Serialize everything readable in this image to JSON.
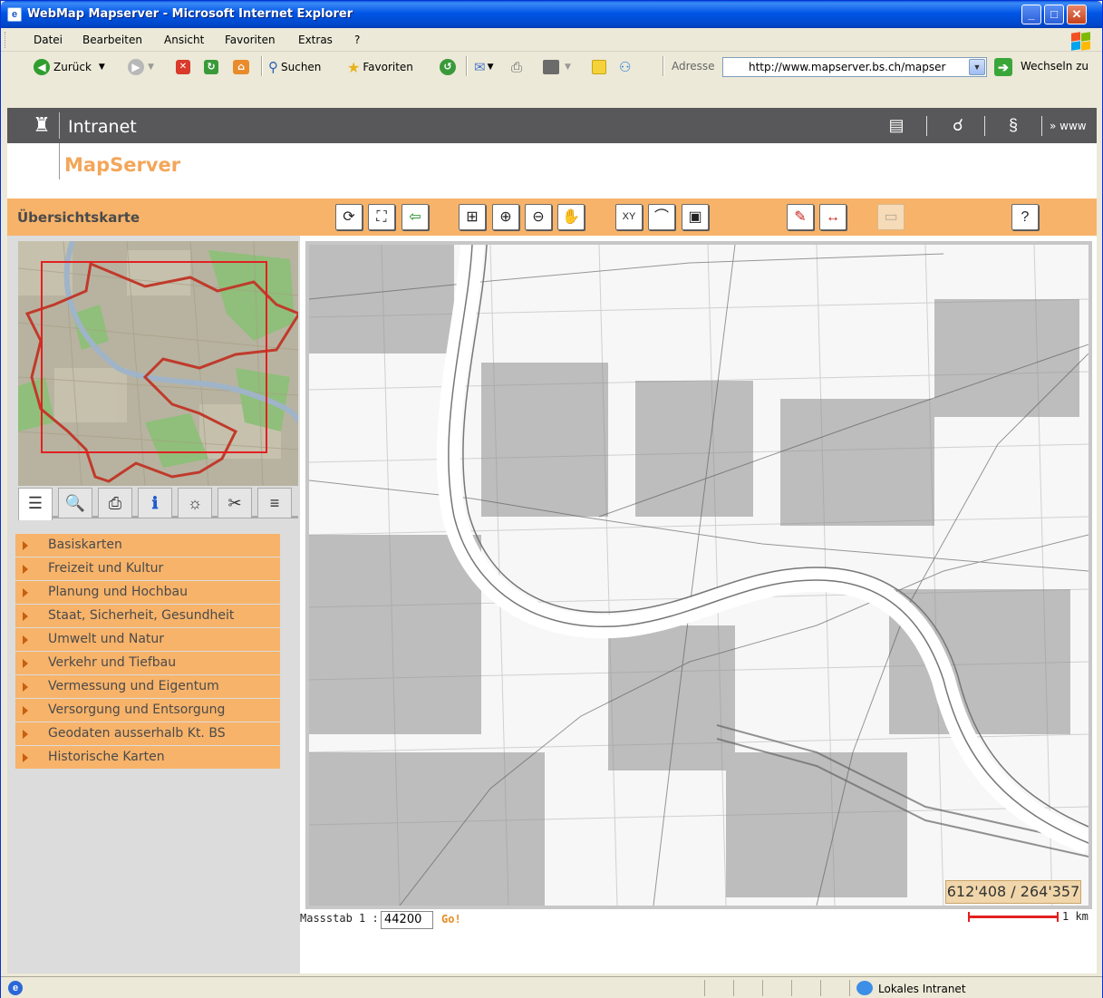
{
  "window": {
    "title": "WebMap Mapserver - Microsoft Internet Explorer",
    "minimize": "_",
    "maximize": "□",
    "close": "✕"
  },
  "menu": [
    "Datei",
    "Bearbeiten",
    "Ansicht",
    "Favoriten",
    "Extras",
    "?"
  ],
  "toolbar": {
    "back": "Zurück",
    "search": "Suchen",
    "favorites": "Favoriten",
    "address_label": "Adresse",
    "address_value": "http://www.mapserver.bs.ch/mapser",
    "go": "Wechseln zu"
  },
  "header": {
    "intranet": "Intranet",
    "www": "» www",
    "app_name": "MapServer"
  },
  "panel": {
    "overview_title": "Übersichtskarte"
  },
  "map_tools": [
    {
      "name": "refresh-icon",
      "glyph": "⟳"
    },
    {
      "name": "full-extent-icon",
      "glyph": "⛶"
    },
    {
      "name": "back-arrow-icon",
      "glyph": "⇦"
    },
    {
      "name": "zoom-box-icon",
      "glyph": "⊞"
    },
    {
      "name": "zoom-in-icon",
      "glyph": "⊕"
    },
    {
      "name": "zoom-out-icon",
      "glyph": "⊖"
    },
    {
      "name": "pan-hand-icon",
      "glyph": "✋"
    },
    {
      "name": "xy-coordinate-icon",
      "glyph": "XY"
    },
    {
      "name": "measure-distance-icon",
      "glyph": "⌒"
    },
    {
      "name": "measure-area-icon",
      "glyph": "▣"
    },
    {
      "name": "label-text-icon",
      "glyph": "✎"
    },
    {
      "name": "distance-arrow-icon",
      "glyph": "↔"
    },
    {
      "name": "clear-graphics-icon",
      "glyph": "▭"
    },
    {
      "name": "help-icon",
      "glyph": "?"
    }
  ],
  "tabs": [
    {
      "name": "legend-tab-icon",
      "glyph": "☰"
    },
    {
      "name": "search-tab-icon",
      "glyph": "🔍"
    },
    {
      "name": "print-tab-icon",
      "glyph": "⎙"
    },
    {
      "name": "info-tab-icon",
      "glyph": "ℹ"
    },
    {
      "name": "query-tab-icon",
      "glyph": "☼"
    },
    {
      "name": "tools-tab-icon",
      "glyph": "✂"
    },
    {
      "name": "layers-tab-icon",
      "glyph": "≡"
    }
  ],
  "layers": [
    "Basiskarten",
    "Freizeit und Kultur",
    "Planung und Hochbau",
    "Staat, Sicherheit, Gesundheit",
    "Umwelt und Natur",
    "Verkehr und Tiefbau",
    "Vermessung und Eigentum",
    "Versorgung und Entsorgung",
    "Geodaten ausserhalb Kt. BS",
    "Historische Karten"
  ],
  "map": {
    "coordinates": "612'408 / 264'357",
    "scale_label": "Massstab 1 :",
    "scale_value": "44200",
    "scale_go": "Go!",
    "scalebar_label": "1 km"
  },
  "status": {
    "zone": "Lokales Intranet"
  },
  "colors": {
    "accent_orange": "#f7b36a",
    "header_dark": "#58585a",
    "mapserver_text": "#f3a65a",
    "extent_red": "#e32020"
  }
}
